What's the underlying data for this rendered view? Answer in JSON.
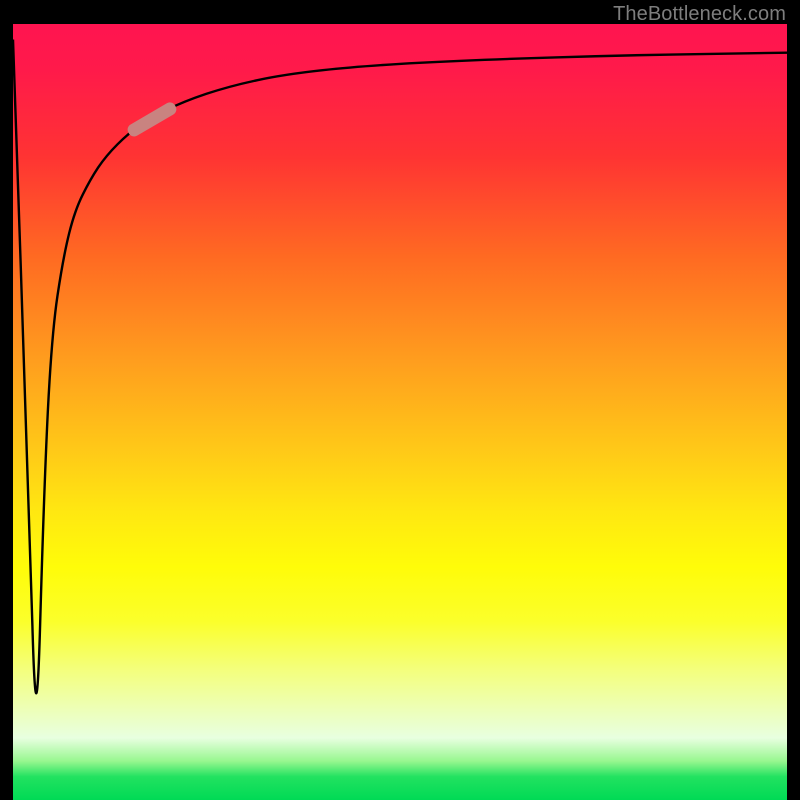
{
  "watermark": "TheBottleneck.com",
  "chart_data": {
    "type": "line",
    "title": "",
    "xlabel": "",
    "ylabel": "",
    "xlim": [
      0,
      100
    ],
    "ylim": [
      0,
      100
    ],
    "note": "Axis values are estimated from gridlines/curve shape; no tick labels are rendered in the image.",
    "series": [
      {
        "name": "curve",
        "x": [
          0,
          2,
          3,
          4,
          5,
          6.5,
          8,
          10,
          12,
          15,
          18,
          22,
          28,
          35,
          45,
          60,
          80,
          100
        ],
        "y": [
          98,
          40,
          5,
          40,
          60,
          70,
          76,
          80,
          83,
          86,
          88,
          90,
          92,
          93.5,
          94.6,
          95.4,
          96,
          96.3
        ]
      }
    ],
    "highlight_segment": {
      "x_range": [
        15,
        21
      ],
      "y_range": [
        80,
        85
      ]
    },
    "background_gradient": {
      "orientation": "vertical",
      "stops": [
        {
          "pos": 0.0,
          "color": "#ff1450"
        },
        {
          "pos": 0.5,
          "color": "#ffcd17"
        },
        {
          "pos": 0.75,
          "color": "#fffc09"
        },
        {
          "pos": 0.95,
          "color": "#e8ffe0"
        },
        {
          "pos": 1.0,
          "color": "#00da55"
        }
      ]
    }
  }
}
